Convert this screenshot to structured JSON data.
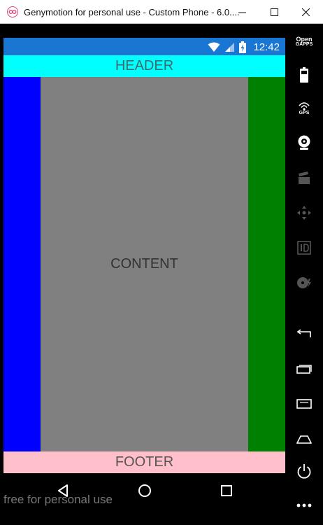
{
  "window": {
    "title": "Genymotion for personal use - Custom Phone - 6.0....",
    "minimize_icon": "minimize-icon",
    "maximize_icon": "maximize-icon",
    "close_icon": "close-icon"
  },
  "statusbar": {
    "time": "12:42",
    "color": "#1976d2"
  },
  "app": {
    "header_label": "HEADER",
    "content_label": "CONTENT",
    "footer_label": "FOOTER",
    "colors": {
      "header": "#00ffff",
      "left": "#0000ff",
      "content": "#808080",
      "right": "#008000",
      "footer": "#ffc0cb"
    }
  },
  "navbar": {
    "back_icon": "back-icon",
    "home_icon": "home-icon",
    "recent_icon": "recent-apps-icon"
  },
  "watermark": "free for personal use",
  "toolbar": {
    "opengapps_line1": "Open",
    "opengapps_line2": "GAPPS",
    "gps_label": "GPS"
  }
}
